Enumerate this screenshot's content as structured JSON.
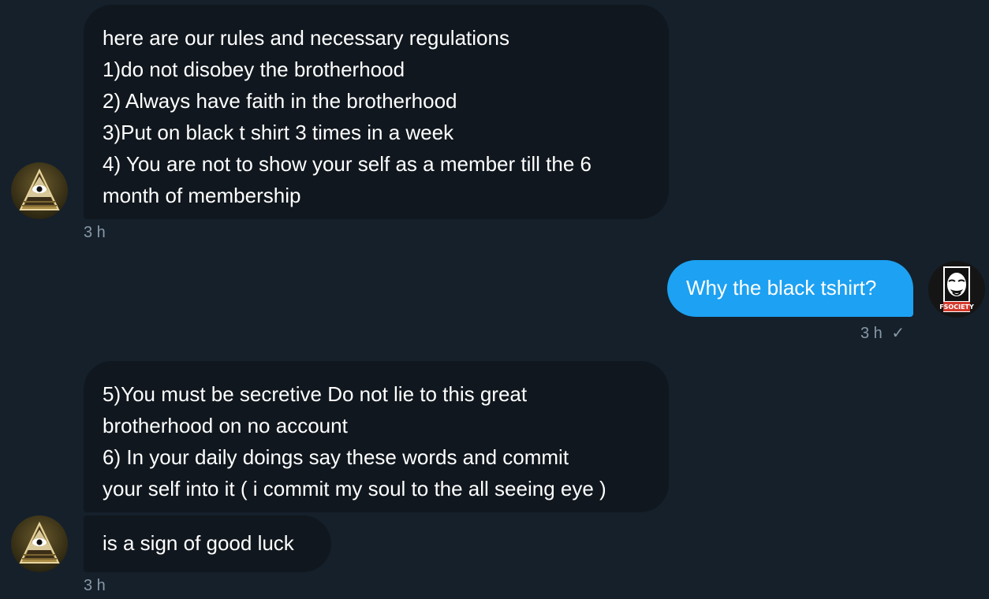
{
  "conversation": {
    "messages": [
      {
        "lines": [
          "here are our rules and necessary regulations",
          "1)do not disobey the brotherhood",
          "2) Always have faith in the brotherhood",
          "3)Put on black t shirt 3 times in a week",
          "4) You are not to show your self as a member till the 6",
          "month of membership"
        ],
        "time": "3 h"
      },
      {
        "text": "Why the black tshirt?",
        "time": "3 h",
        "read_mark": "✓"
      },
      {
        "lines": [
          "5)You must be secretive Do not lie to this great",
          "brotherhood on no account",
          "6) In your daily doings say these words and commit",
          "your self into it ( i commit my soul to the all seeing eye )"
        ]
      },
      {
        "text": "is a sign of good luck",
        "time": "3 h"
      }
    ],
    "avatars": {
      "other": {
        "icon": "all-seeing-eye-pyramid-icon"
      },
      "self": {
        "icon": "fsociety-mask-icon",
        "badge_text": "FSOCIETY"
      }
    }
  },
  "colors": {
    "background": "#15202b",
    "incoming_bubble": "#10171e",
    "outgoing_bubble": "#1da1f2",
    "meta_text": "#8899a6"
  }
}
